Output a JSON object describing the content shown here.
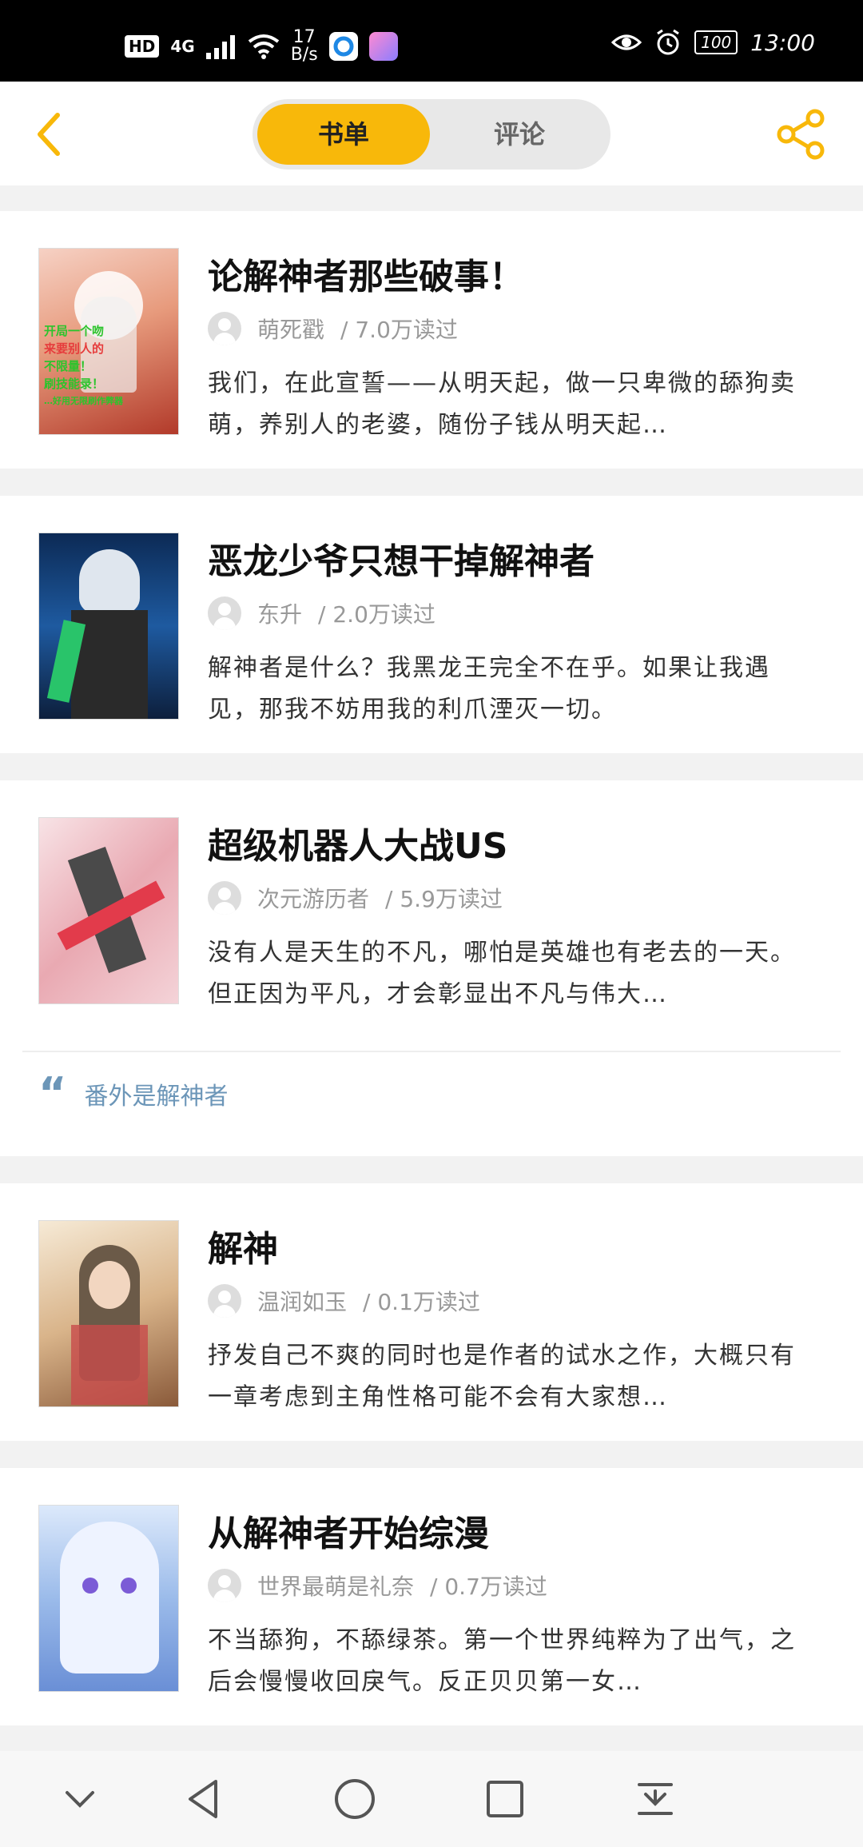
{
  "status_bar": {
    "hd": "HD",
    "network": "4G",
    "speed_value": "17",
    "speed_unit": "B/s",
    "battery": "100",
    "time": "13:00"
  },
  "header": {
    "tabs": [
      {
        "label": "书单",
        "active": true
      },
      {
        "label": "评论",
        "active": false
      }
    ]
  },
  "books": [
    {
      "title": "论解神者那些破事！",
      "author": "萌死戳",
      "reads": "/ 7.0万读过",
      "desc": "我们，在此宣誓——从明天起，做一只卑微的舔狗卖萌，养别人的老婆，随份子钱从明天起…"
    },
    {
      "title": "恶龙少爷只想干掉解神者",
      "author": "东升",
      "reads": "/ 2.0万读过",
      "desc": "解神者是什么？我黑龙王完全不在乎。如果让我遇见，那我不妨用我的利爪湮灭一切。"
    },
    {
      "title": "超级机器人大战US",
      "author": "次元游历者",
      "reads": "/ 5.9万读过",
      "desc": "没有人是天生的不凡，哪怕是英雄也有老去的一天。但正因为平凡，才会彰显出不凡与伟大…",
      "comment": "番外是解神者"
    },
    {
      "title": "解神",
      "author": "温润如玉",
      "reads": "/ 0.1万读过",
      "desc": "抒发自己不爽的同时也是作者的试水之作，大概只有一章考虑到主角性格可能不会有大家想…"
    },
    {
      "title": "从解神者开始综漫",
      "author": "世界最萌是礼奈",
      "reads": "/ 0.7万读过",
      "desc": "不当舔狗，不舔绿茶。第一个世界纯粹为了出气，之后会慢慢收回戾气。反正贝贝第一女…"
    }
  ],
  "cover_texts": [
    "开局一个吻",
    "来要别人的",
    "不限量！",
    "刷技能录！",
    "…好用无限刷作弊器"
  ],
  "colors": {
    "accent": "#f8b80a",
    "quote": "#6c96b8"
  }
}
